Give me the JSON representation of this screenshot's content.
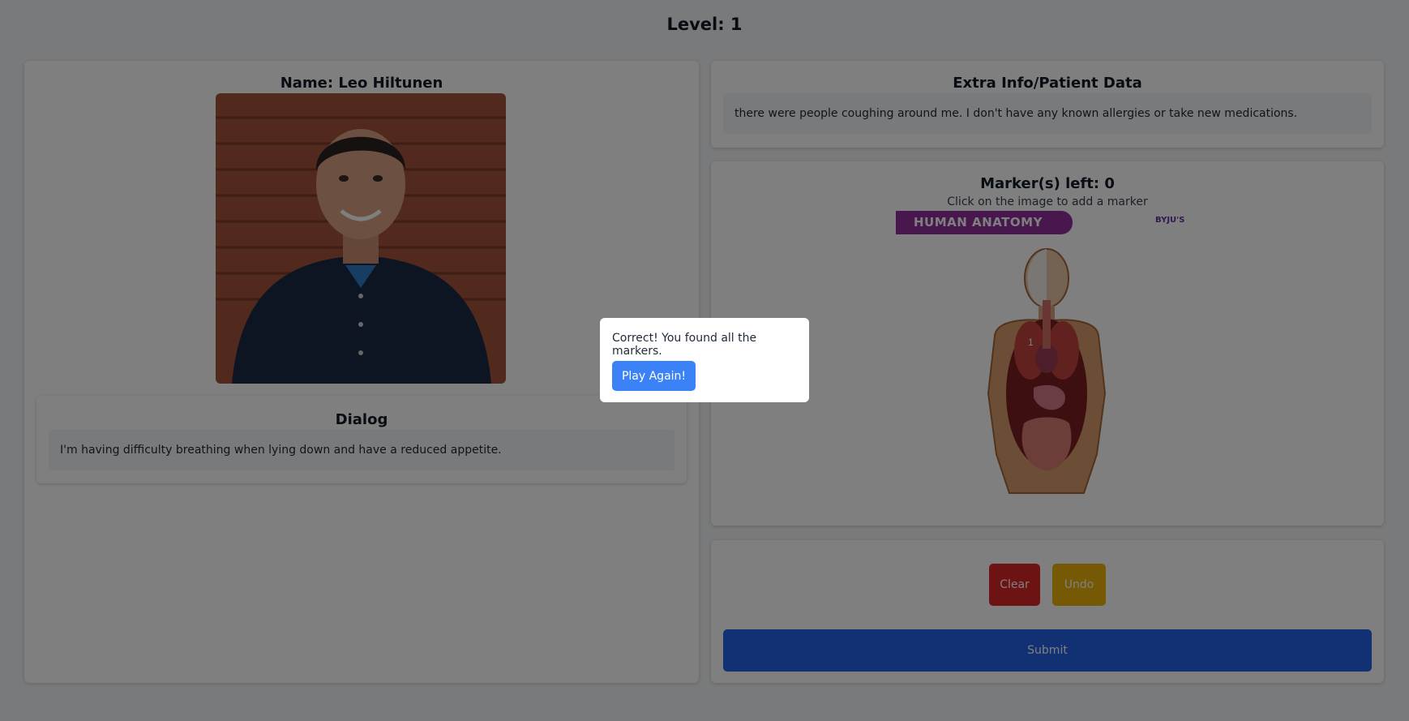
{
  "header": {
    "level_text": "Level: 1"
  },
  "patient": {
    "name_text": "Name: Leo Hiltunen",
    "photo_alt": "Leo Hiltunen"
  },
  "dialog": {
    "title": "Dialog",
    "text": "I'm having difficulty breathing when lying down and have a reduced appetite."
  },
  "extra_info": {
    "title": "Extra Info/Patient Data",
    "text": "there were people coughing around me. I don't have any known allergies or take new medications."
  },
  "markers": {
    "title": "Marker(s) left: 0",
    "hint": "Click on the image to add a marker",
    "image_banner": "HUMAN ANATOMY",
    "image_logo": "BYJU'S",
    "placed": [
      "1"
    ]
  },
  "actions": {
    "clear_label": "Clear",
    "undo_label": "Undo",
    "submit_label": "Submit"
  },
  "modal": {
    "message": "Correct! You found all the markers.",
    "button_label": "Play Again!"
  },
  "colors": {
    "clear": "#dc2626",
    "undo": "#eab308",
    "submit": "#2563eb",
    "play_again": "#3b82f6",
    "banner": "#8e2f9a"
  }
}
